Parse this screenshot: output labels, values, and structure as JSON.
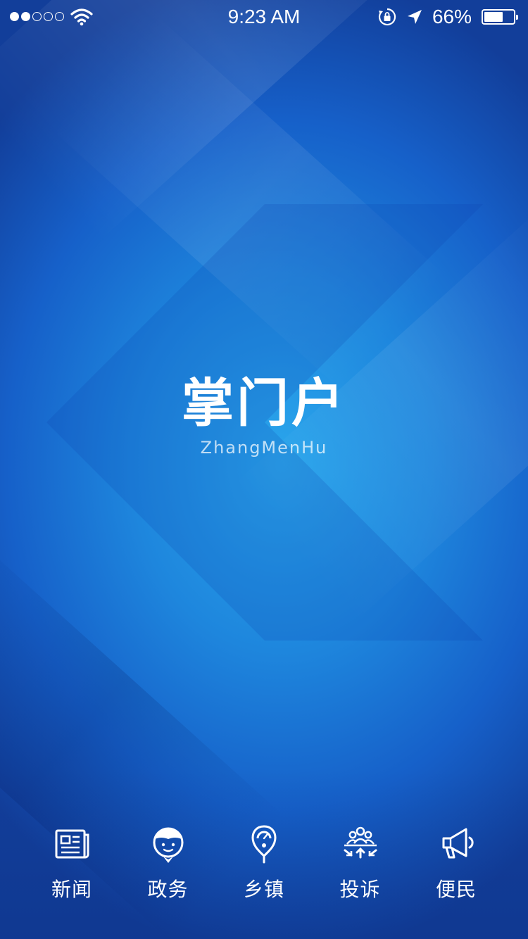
{
  "status_bar": {
    "signal_bars": 5,
    "signal_filled": 2,
    "time": "9:23 AM",
    "battery_text": "66%",
    "battery_level": 0.66
  },
  "brand": {
    "title": "掌门户",
    "subtitle": "ZhangMenHu"
  },
  "nav": {
    "items": [
      {
        "label": "新闻",
        "icon": "newspaper-icon"
      },
      {
        "label": "政务",
        "icon": "official-person-icon"
      },
      {
        "label": "乡镇",
        "icon": "location-pin-icon"
      },
      {
        "label": "投诉",
        "icon": "complaint-group-icon"
      },
      {
        "label": "便民",
        "icon": "megaphone-icon"
      }
    ]
  },
  "colors": {
    "background_center": "#2aa6ec",
    "background_edge": "#123e9a",
    "foreground": "#ffffff"
  }
}
